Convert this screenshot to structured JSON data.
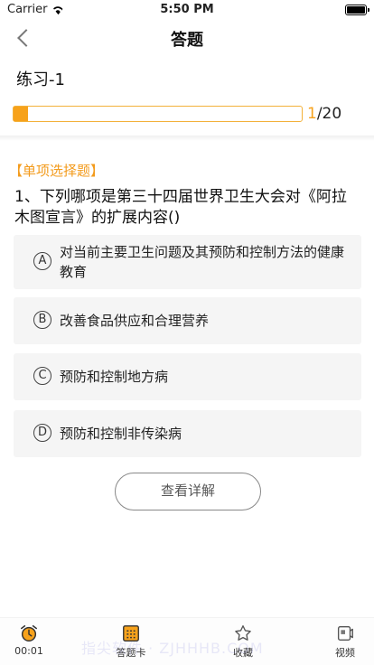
{
  "status": {
    "carrier": "Carrier",
    "time": "5:50 PM"
  },
  "nav": {
    "title": "答题"
  },
  "practice": {
    "name": "练习-1",
    "current": "1",
    "total": "/20",
    "progress": 0.05
  },
  "question": {
    "type": "【单项选择题】",
    "stem": "1、下列哪项是第三十四届世界卫生大会对《阿拉木图宣言》的扩展内容()",
    "options": [
      {
        "letter": "A",
        "text": "对当前主要卫生问题及其预防和控制方法的健康教育"
      },
      {
        "letter": "B",
        "text": "改善食品供应和合理营养"
      },
      {
        "letter": "C",
        "text": "预防和控制地方病"
      },
      {
        "letter": "D",
        "text": "预防和控制非传染病"
      }
    ]
  },
  "detail_button": "查看详解",
  "tabs": [
    {
      "label": "00:01",
      "icon": "alarm-clock-icon"
    },
    {
      "label": "答题卡",
      "icon": "answer-card-icon"
    },
    {
      "label": "收藏",
      "icon": "star-icon"
    },
    {
      "label": "视频",
      "icon": "video-icon"
    }
  ],
  "watermark": "指尖软件 · ZJHHHB.COM",
  "colors": {
    "accent": "#f7a21b",
    "option_bg": "#f5f5f5"
  }
}
